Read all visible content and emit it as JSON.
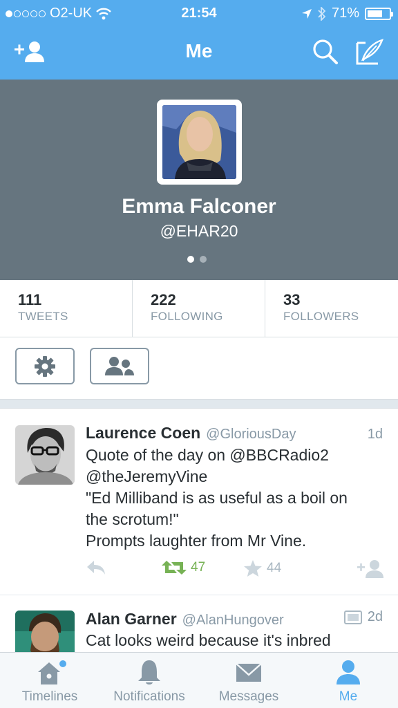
{
  "status_bar": {
    "carrier": "O2-UK",
    "time": "21:54",
    "battery": "71%",
    "battery_level": 0.71,
    "signal_bars_filled": 1
  },
  "nav": {
    "title": "Me",
    "icons": [
      "add-user-icon",
      "search-icon",
      "compose-icon"
    ]
  },
  "profile": {
    "name": "Emma Falconer",
    "handle": "@EHAR20",
    "page_count": 2,
    "active_page": 1
  },
  "stats": [
    {
      "value": "111",
      "label": "TWEETS"
    },
    {
      "value": "222",
      "label": "FOLLOWING"
    },
    {
      "value": "33",
      "label": "FOLLOWERS"
    }
  ],
  "actions": {
    "icons": [
      "gear-icon",
      "people-icon"
    ]
  },
  "tweets": [
    {
      "name": "Laurence Coen",
      "handle": "@GloriousDay",
      "time": "1d",
      "lines": [
        "Quote of the day on @BBCRadio2",
        "@theJeremyVine",
        "\"Ed Milliband is as useful as a boil on",
        "the scrotum!\"",
        "Prompts laughter from Mr Vine."
      ],
      "retweets": "47",
      "favorites": "44"
    },
    {
      "name": "Alan Garner",
      "handle": "@AlanHungover",
      "time": "2d",
      "lines": [
        "Cat looks weird because it's inbred"
      ]
    }
  ],
  "tabbar": {
    "items": [
      {
        "label": "Timelines",
        "icon": "home-icon"
      },
      {
        "label": "Notifications",
        "icon": "bell-icon"
      },
      {
        "label": "Messages",
        "icon": "envelope-icon"
      },
      {
        "label": "Me",
        "icon": "person-icon"
      }
    ],
    "active": "Me"
  },
  "colors": {
    "brand_blue": "#55acee",
    "header_gray": "#66757f",
    "retweet_green": "#77b255",
    "muted": "#8899a6"
  }
}
